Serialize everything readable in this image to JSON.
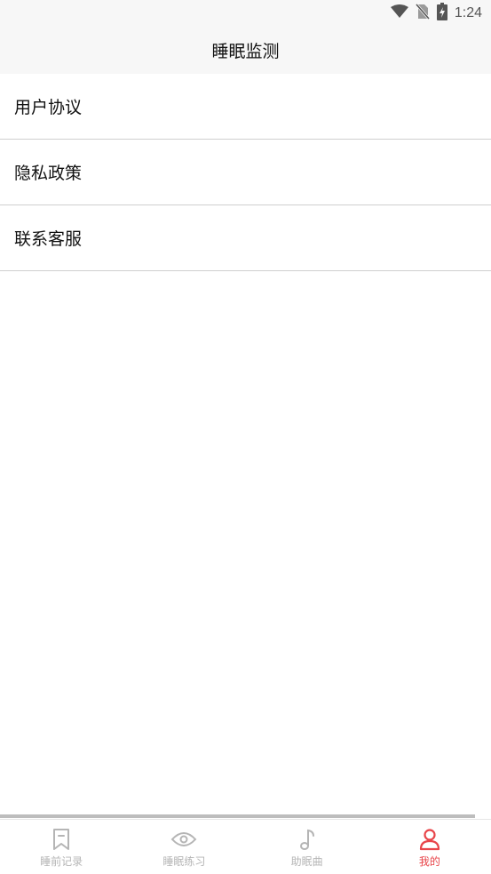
{
  "status_bar": {
    "time": "1:24",
    "icons": [
      "wifi-icon",
      "no-sim-icon",
      "battery-charging-icon"
    ]
  },
  "header": {
    "title": "睡眠监测"
  },
  "menu": {
    "items": [
      {
        "label": "用户协议"
      },
      {
        "label": "隐私政策"
      },
      {
        "label": "联系客服"
      }
    ]
  },
  "tab_bar": {
    "accent_color": "#e8454a",
    "inactive_color": "#b5b5b5",
    "tabs": [
      {
        "label": "睡前记录",
        "icon": "bookmark-icon",
        "active": false
      },
      {
        "label": "睡眠练习",
        "icon": "eye-icon",
        "active": false
      },
      {
        "label": "助眠曲",
        "icon": "music-note-icon",
        "active": false
      },
      {
        "label": "我的",
        "icon": "person-icon",
        "active": true
      }
    ]
  }
}
